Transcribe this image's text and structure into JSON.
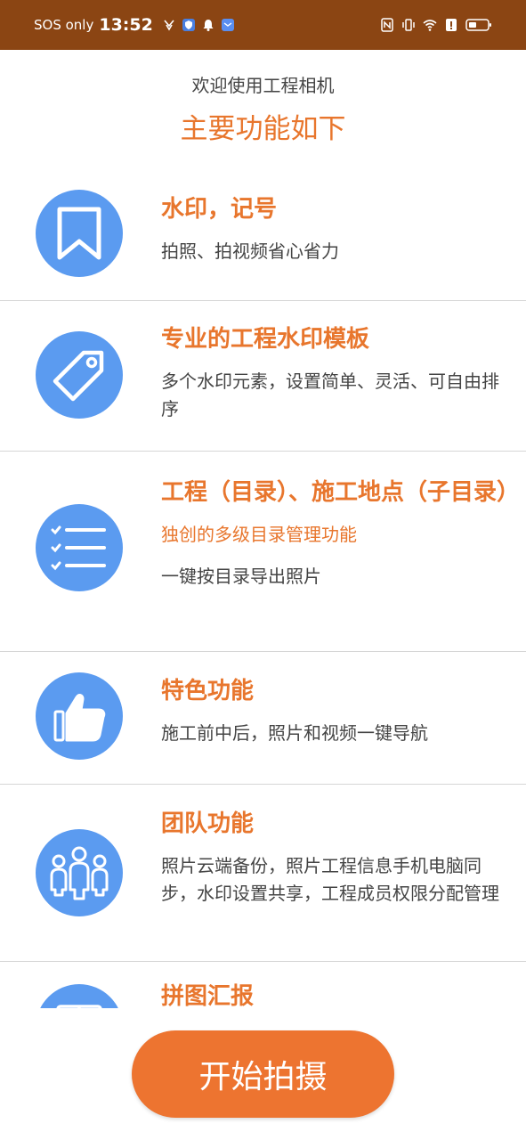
{
  "status_bar": {
    "sos": "SOS only",
    "time": "13:52"
  },
  "header": {
    "welcome": "欢迎使用工程相机",
    "title": "主要功能如下"
  },
  "features": [
    {
      "icon": "bookmark-icon",
      "title": "水印，记号",
      "desc": "拍照、拍视频省心省力"
    },
    {
      "icon": "tag-icon",
      "title": "专业的工程水印模板",
      "desc": "多个水印元素，设置简单、灵活、可自由排序"
    },
    {
      "icon": "list-icon",
      "title": "工程（目录）、施工地点（子目录）",
      "desc": "独创的多级目录管理功能",
      "desc2": "一键按目录导出照片"
    },
    {
      "icon": "thumbs-up-icon",
      "title": "特色功能",
      "desc": "施工前中后，照片和视频一键导航"
    },
    {
      "icon": "team-icon",
      "title": "团队功能",
      "desc": "照片云端备份，照片工程信息手机电脑同步，水印设置共享，工程成员权限分配管理"
    },
    {
      "icon": "puzzle-icon",
      "title": "拼图汇报"
    }
  ],
  "start_button": "开始拍摄",
  "colors": {
    "status_bar": "#8B4513",
    "accent": "#E8762D",
    "icon_bg": "#5B9BF0",
    "button": "#ED7430"
  }
}
